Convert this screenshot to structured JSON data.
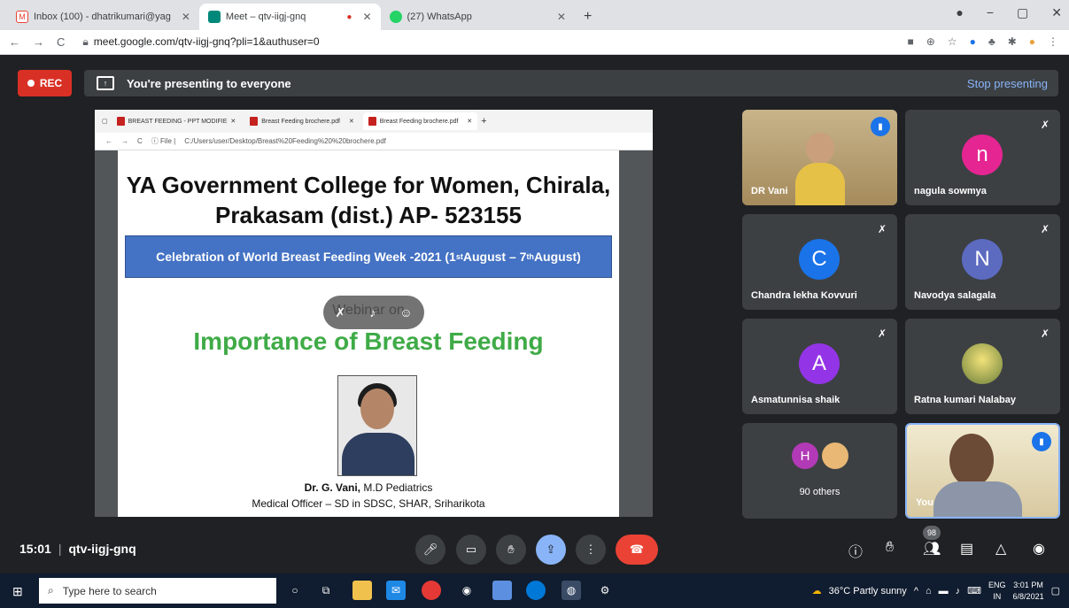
{
  "browser": {
    "tabs": [
      {
        "label": "Inbox (100) - dhatrikumari@yag",
        "active": false
      },
      {
        "label": "Meet – qtv-iigj-gnq",
        "active": true
      },
      {
        "label": "(27) WhatsApp",
        "active": false
      }
    ],
    "url": "meet.google.com/qtv-iigj-gnq?pli=1&authuser=0"
  },
  "meet": {
    "rec_label": "REC",
    "presenting_text": "You're presenting to everyone",
    "stop_presenting": "Stop presenting",
    "meeting_time": "15:01",
    "meeting_code": "qtv-iigj-gnq",
    "participants_count": "98"
  },
  "shared_window": {
    "tabs": [
      "BREAST FEEDING - PPT MODIFIE",
      "Breast Feeding brochere.pdf",
      "Breast Feeding brochere.pdf"
    ],
    "address_prefix": "File",
    "address": "C:/Users/user/Desktop/Breast%20Feeding%20%20brochere.pdf"
  },
  "slide": {
    "college_line1": "YA Government College for Women, Chirala,",
    "college_line2": "Prakasam (dist.) AP- 523155",
    "banner_pre": "Celebration of World Breast Feeding Week -2021 (1",
    "banner_sup1": "st",
    "banner_mid": " August – 7",
    "banner_sup2": "th",
    "banner_post": " August)",
    "webinar": "Webinar on",
    "topic": "Importance of Breast Feeding",
    "doctor_name": "Dr. G. Vani,",
    "doctor_qual": " M.D Pediatrics",
    "officer": "Medical Officer – SD in SDSC, SHAR, Sriharikota"
  },
  "participants": [
    {
      "name": "DR Vani",
      "type": "video"
    },
    {
      "name": "nagula sowmya",
      "initial": "n",
      "color": "#e52592"
    },
    {
      "name": "Chandra lekha Kovvuri",
      "initial": "C",
      "color": "#1a73e8"
    },
    {
      "name": "Navodya salagala",
      "initial": "N",
      "color": "#5c6bc0"
    },
    {
      "name": "Asmatunnisa shaik",
      "initial": "A",
      "color": "#9334e6"
    },
    {
      "name": "Ratna kumari Nalabay",
      "type": "image"
    },
    {
      "name": "90 others",
      "initial": "H"
    },
    {
      "name": "You",
      "type": "video"
    }
  ],
  "taskbar": {
    "search_placeholder": "Type here to search",
    "weather": "36°C  Partly sunny",
    "lang1": "ENG",
    "lang2": "IN",
    "time": "3:01 PM",
    "date": "6/8/2021"
  },
  "colors": {
    "rec_red": "#d93025",
    "accent_blue": "#8ab4f8",
    "end_call": "#ea4335",
    "topic_green": "#3fab47",
    "banner_blue": "#4472c4"
  }
}
